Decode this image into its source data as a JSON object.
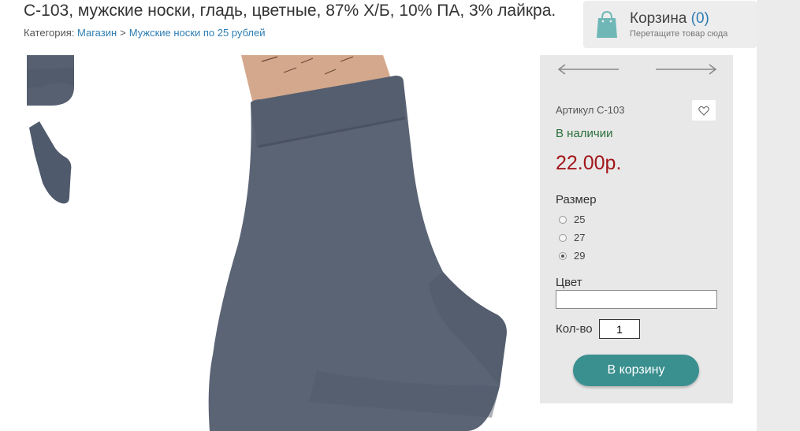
{
  "product": {
    "title": "С-103, мужские носки, гладь, цветные, 87% Х/Б, 10% ПА, 3% лайкра."
  },
  "breadcrumbs": {
    "label": "Категория:",
    "items": [
      "Магазин",
      "Мужские носки по 25 рублей"
    ],
    "separator": ">"
  },
  "cart": {
    "title": "Корзина",
    "count": "(0)",
    "hint": "Перетащите товар сюда"
  },
  "gallery": {
    "thumbnails": [
      "sock-thumb-top",
      "sock-thumb-full"
    ],
    "main_image": "sock-main-image"
  },
  "panel": {
    "sku": "Артикул С-103",
    "stock": "В наличии",
    "price": "22.00р.",
    "size_label": "Размер",
    "sizes": [
      "25",
      "27",
      "29"
    ],
    "selected_size": "29",
    "color_label": "Цвет",
    "color_value": "",
    "qty_label": "Кол-во",
    "qty_value": "1",
    "add_button": "В корзину"
  },
  "colors": {
    "accent": "#3a8f8f",
    "link": "#2d7db3",
    "price": "#a3171b",
    "stock": "#2a6e3a",
    "panel_bg": "#e8e8e8",
    "sock": "#5a6270"
  }
}
